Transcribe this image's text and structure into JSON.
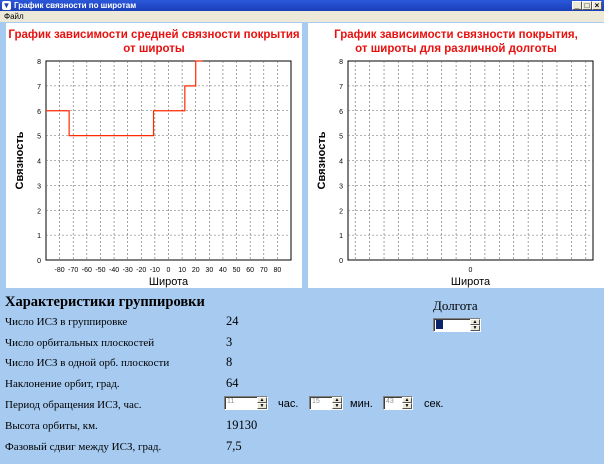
{
  "window": {
    "title": "График связности по широтам",
    "icon": "app-icon"
  },
  "menu": {
    "items": [
      "Файл"
    ]
  },
  "chart_left": {
    "title_line1": "График зависимости средней связности покрытия",
    "title_line2": "от широты",
    "xlabel": "Широта",
    "ylabel": "Связность"
  },
  "chart_right": {
    "title_line1": "График зависимости  связности покрытия,",
    "title_line2": "от широты для различной долготы",
    "xlabel": "Широта",
    "ylabel": "Связность"
  },
  "chart_data": [
    {
      "type": "line",
      "title": "График зависимости средней связности покрытия от широты",
      "xlabel": "Широта",
      "ylabel": "Связность",
      "xlim": [
        -90,
        90
      ],
      "ylim": [
        0,
        8
      ],
      "xticks": [
        "-80",
        "-70",
        "-60",
        "-50",
        "-40",
        "-30",
        "-20",
        "-10",
        "0",
        "10",
        "20",
        "30",
        "40",
        "50",
        "60",
        "70",
        "80"
      ],
      "yticks": [
        "0",
        "1",
        "2",
        "3",
        "4",
        "5",
        "6",
        "7",
        "8"
      ],
      "grid": true,
      "series": [
        {
          "color": "#ff2a00",
          "x": [
            -90,
            -73,
            -73,
            -11,
            -11,
            12,
            12,
            20,
            20,
            25,
            25
          ],
          "y": [
            6,
            6,
            5,
            5,
            6,
            6,
            7,
            7,
            8,
            8,
            8.5
          ]
        }
      ]
    },
    {
      "type": "line",
      "title": "График зависимости  связности покрытия, от широты для различной долготы",
      "xlabel": "Широта",
      "ylabel": "Связность",
      "ylim": [
        0,
        8
      ],
      "xticks": [
        "0"
      ],
      "yticks": [
        "0",
        "1",
        "2",
        "3",
        "4",
        "5",
        "6",
        "7",
        "8"
      ],
      "grid": true,
      "series": []
    }
  ],
  "params": {
    "heading": "Характеристики группировки",
    "rows": [
      {
        "label": "Число ИСЗ в группировке",
        "value": "24"
      },
      {
        "label": "Число орбитальных плоскостей",
        "value": "3"
      },
      {
        "label": "Число ИСЗ в одной орб. плоскости",
        "value": "8"
      },
      {
        "label": "Наклонение орбит, град.",
        "value": "64"
      },
      {
        "label": "Период обращения ИСЗ, час.",
        "value": ""
      },
      {
        "label": "Высота орбиты, км.",
        "value": "19130"
      },
      {
        "label": "Фазовый сдвиг между ИСЗ, град.",
        "value": "7,5"
      }
    ],
    "period": {
      "hours": "11",
      "hours_unit": "час.",
      "minutes": "15",
      "minutes_unit": "мин.",
      "seconds": "43",
      "seconds_unit": "сек."
    }
  },
  "longitude": {
    "label": "Долгота",
    "value": ""
  }
}
